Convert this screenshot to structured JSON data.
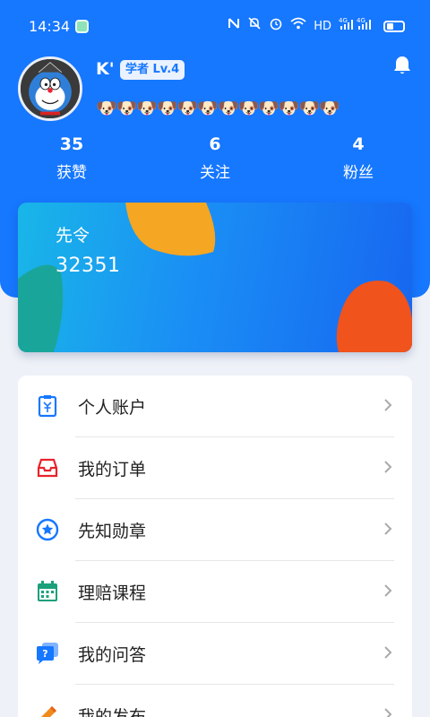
{
  "status_bar": {
    "time": "14:34",
    "icons": [
      "nfc-icon",
      "mute-icon",
      "alarm-icon",
      "wifi-icon",
      "signal-icon",
      "battery-icon"
    ],
    "hd_label": "HD",
    "net1": "4G",
    "net2": "4G"
  },
  "profile": {
    "username": "K'",
    "level": "学者 Lv.4",
    "bio": "🐶🐶🐶🐶🐶🐶🐶🐶🐶🐶🐶🐶"
  },
  "stats": [
    {
      "value": "35",
      "label": "获赞"
    },
    {
      "value": "6",
      "label": "关注"
    },
    {
      "value": "4",
      "label": "粉丝"
    }
  ],
  "card": {
    "title": "先令",
    "value": "32351"
  },
  "menu": {
    "items": [
      {
        "label": "个人账户",
        "icon": "account-icon"
      },
      {
        "label": "我的订单",
        "icon": "order-tray-icon"
      },
      {
        "label": "先知勋章",
        "icon": "star-badge-icon"
      },
      {
        "label": "理赔课程",
        "icon": "calendar-icon"
      },
      {
        "label": "我的问答",
        "icon": "question-chat-icon"
      },
      {
        "label": "我的发布",
        "icon": "pencil-icon"
      }
    ]
  },
  "colors": {
    "primary": "#1677ff",
    "card_orange": "#f5a623",
    "card_red": "#f0531c",
    "card_teal": "#1aa59a"
  }
}
